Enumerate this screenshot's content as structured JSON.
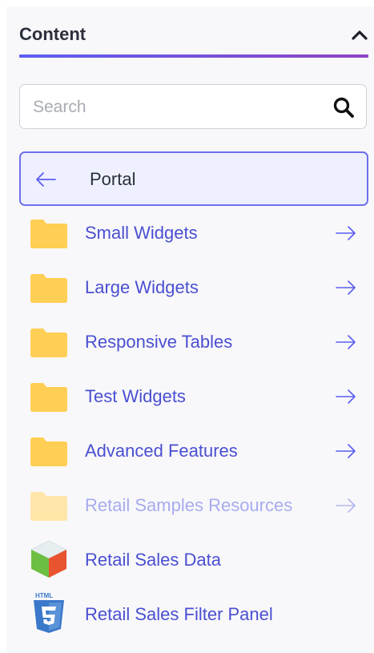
{
  "panel": {
    "title": "Content",
    "collapse_icon": "chevron-up-icon"
  },
  "search": {
    "placeholder": "Search",
    "value": "",
    "icon": "search-icon"
  },
  "breadcrumb": {
    "back_icon": "arrow-left-icon",
    "label": "Portal"
  },
  "items": [
    {
      "label": "Small Widgets",
      "icon": "folder-icon",
      "dimmed": false
    },
    {
      "label": "Large Widgets",
      "icon": "folder-icon",
      "dimmed": false
    },
    {
      "label": "Responsive Tables",
      "icon": "folder-icon",
      "dimmed": false
    },
    {
      "label": "Test Widgets",
      "icon": "folder-icon",
      "dimmed": false
    },
    {
      "label": "Advanced Features",
      "icon": "folder-icon",
      "dimmed": false
    },
    {
      "label": "Retail Samples Resources",
      "icon": "folder-icon",
      "dimmed": true
    },
    {
      "label": "Retail Sales Data",
      "icon": "data-cube-icon",
      "dimmed": false
    },
    {
      "label": "Retail Sales Filter Panel",
      "icon": "html5-icon",
      "dimmed": false
    }
  ],
  "html5_badge_text": "HTML",
  "colors": {
    "accent": "#5b5df2",
    "link": "#4a4fd1",
    "folder": "#ffce54"
  }
}
